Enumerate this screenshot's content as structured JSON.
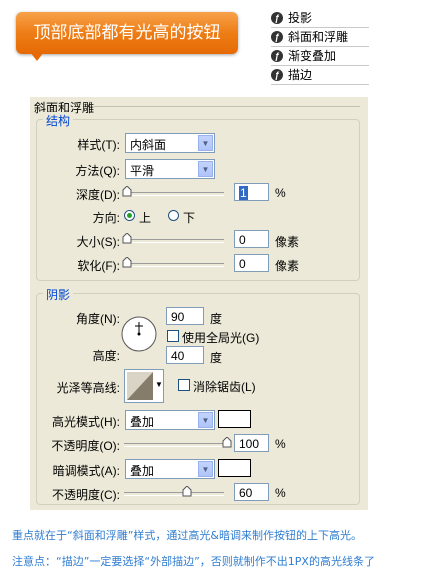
{
  "banner": {
    "text": "顶部底部都有光高的按钮"
  },
  "style_list": [
    {
      "label": "投影"
    },
    {
      "label": "斜面和浮雕"
    },
    {
      "label": "渐变叠加"
    },
    {
      "label": "描边"
    }
  ],
  "dialog": {
    "title": "斜面和浮雕",
    "structure": {
      "title": "结构",
      "style_label": "样式(T):",
      "style_value": "内斜面",
      "method_label": "方法(Q):",
      "method_value": "平滑",
      "depth_label": "深度(D):",
      "depth_value": "1",
      "depth_unit": "%",
      "direction_label": "方向:",
      "direction_up": "上",
      "direction_down": "下",
      "size_label": "大小(S):",
      "size_value": "0",
      "size_unit": "像素",
      "soften_label": "软化(F):",
      "soften_value": "0",
      "soften_unit": "像素"
    },
    "shading": {
      "title": "阴影",
      "angle_label": "角度(N):",
      "angle_value": "90",
      "angle_unit": "度",
      "global_light_label": "使用全局光(G)",
      "altitude_label": "高度:",
      "altitude_value": "40",
      "altitude_unit": "度",
      "contour_label": "光泽等高线:",
      "antialias_label": "消除锯齿(L)",
      "highlight_mode_label": "高光模式(H):",
      "highlight_mode_value": "叠加",
      "highlight_opacity_label": "不透明度(O):",
      "highlight_opacity_value": "100",
      "highlight_opacity_unit": "%",
      "shadow_mode_label": "暗调模式(A):",
      "shadow_mode_value": "叠加",
      "shadow_opacity_label": "不透明度(C):",
      "shadow_opacity_value": "60",
      "shadow_opacity_unit": "%"
    }
  },
  "footer": {
    "line1": "重点就在于“斜面和浮雕”样式，通过高光&暗调来制作按钮的上下高光。",
    "line2": "注意点：“描边”一定要选择“外部描边”，否则就制作不出1PX的高光线条了"
  },
  "colors": {
    "banner": "#ee7d16",
    "footer_text": "#2f7dd1",
    "panel": "#ece9d8",
    "group_title": "#0046d5"
  }
}
